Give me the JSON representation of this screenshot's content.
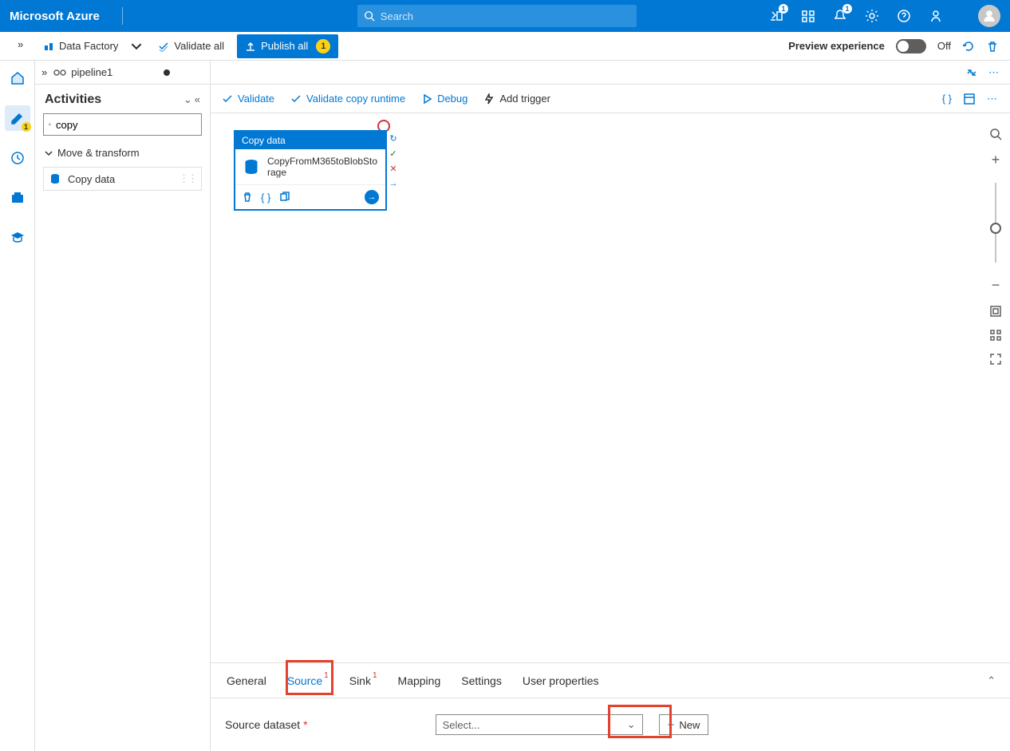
{
  "header": {
    "brand": "Microsoft Azure",
    "search_placeholder": "Search",
    "cloudshell_badge": "1",
    "notif_badge": "1"
  },
  "toolbar": {
    "datafactory": "Data Factory",
    "validate_all": "Validate all",
    "publish_all": "Publish all",
    "publish_count": "1",
    "preview_label": "Preview experience",
    "toggle_state": "Off"
  },
  "leftbar": {
    "author_badge": "1"
  },
  "tabs": {
    "pipeline": "pipeline1"
  },
  "activities": {
    "title": "Activities",
    "search_value": "copy",
    "group": "Move & transform",
    "item": "Copy data"
  },
  "canvas_toolbar": {
    "validate": "Validate",
    "validate_copy": "Validate copy runtime",
    "debug": "Debug",
    "add_trigger": "Add trigger"
  },
  "node": {
    "title": "Copy data",
    "name": "CopyFromM365toBlobStorage"
  },
  "props": {
    "tabs": {
      "general": "General",
      "source": "Source",
      "source_badge": "1",
      "sink": "Sink",
      "sink_badge": "1",
      "mapping": "Mapping",
      "settings": "Settings",
      "userprops": "User properties"
    },
    "field_label": "Source dataset",
    "select_placeholder": "Select...",
    "new_label": "New"
  }
}
